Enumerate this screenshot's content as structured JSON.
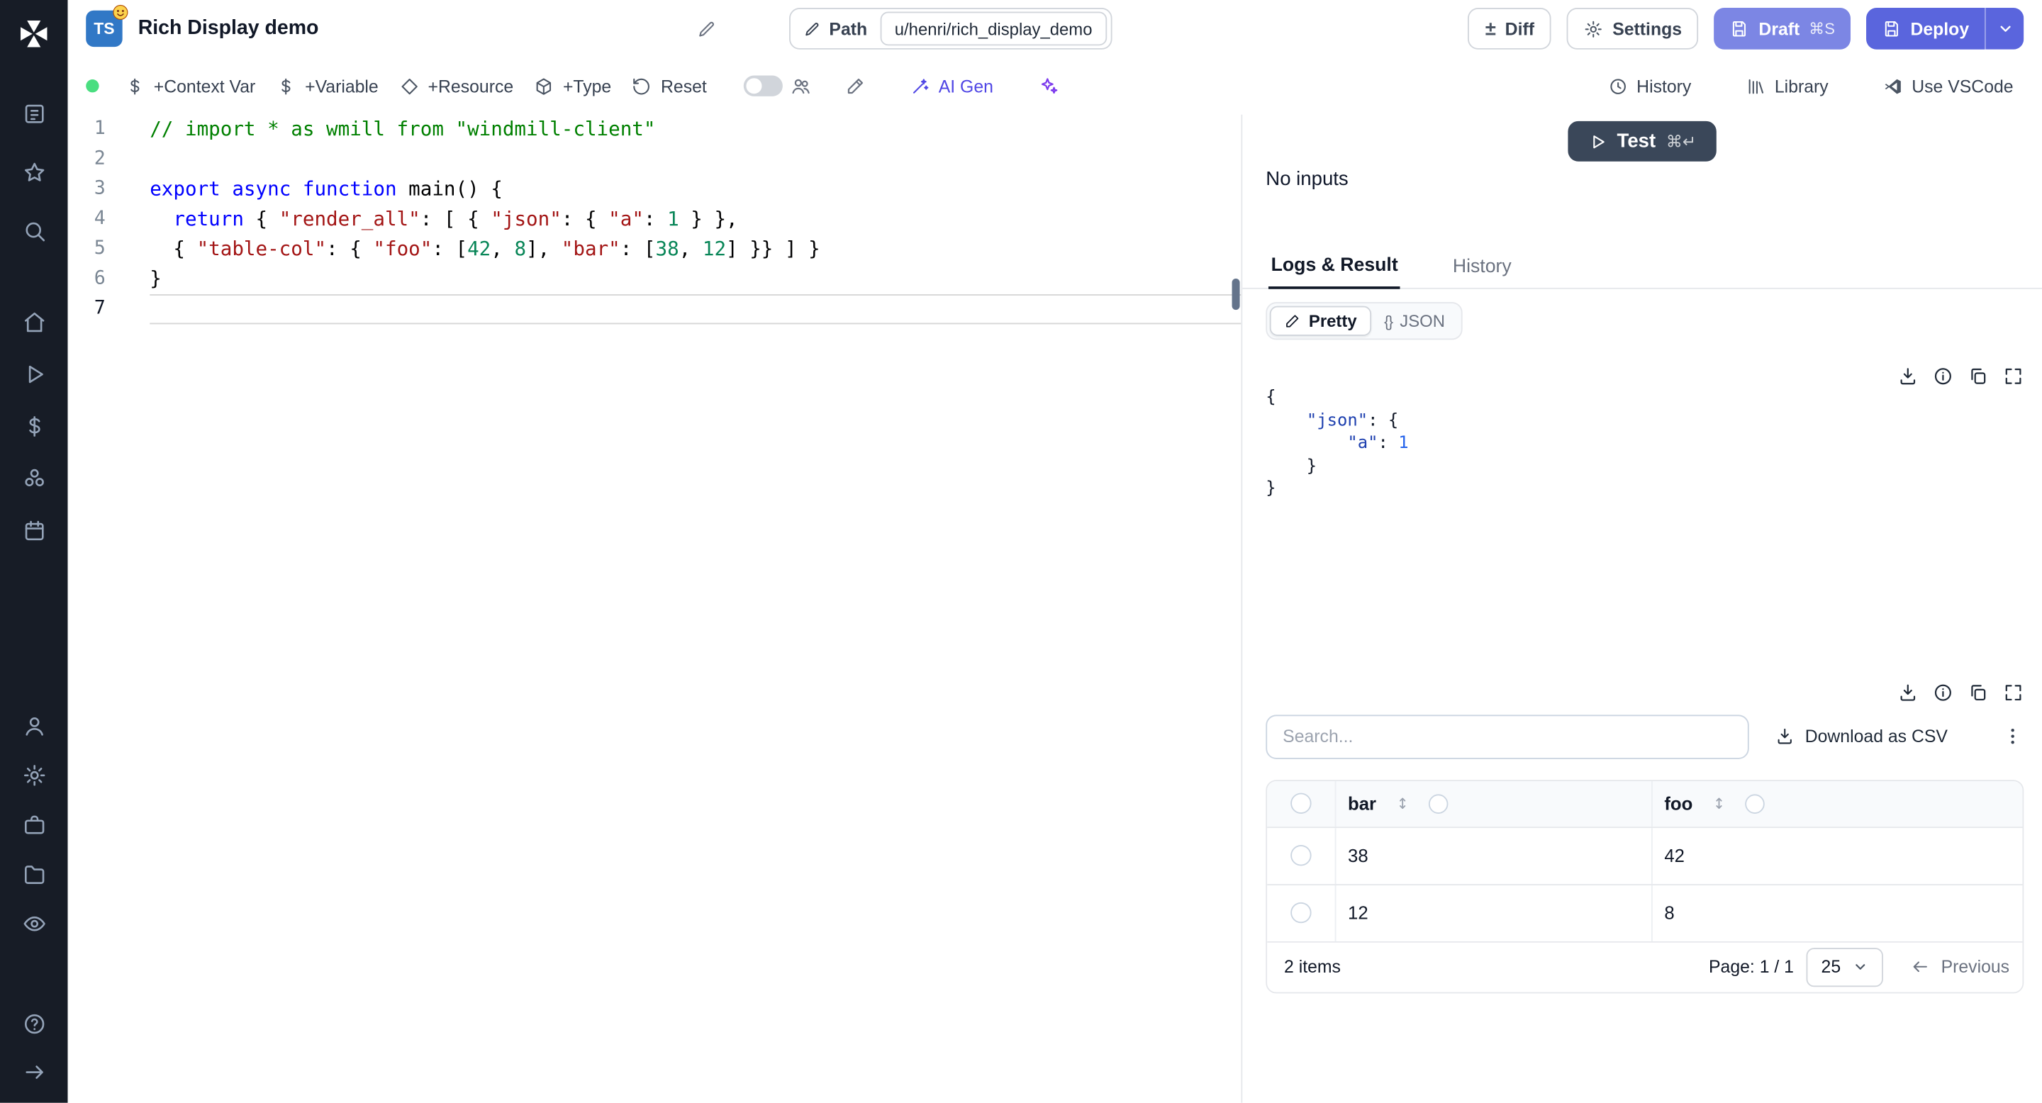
{
  "header": {
    "lang_badge": "TS",
    "title": "Rich Display demo",
    "path_label": "Path",
    "path_value": "u/henri/rich_display_demo",
    "diff_icon": "±",
    "diff_label": "Diff",
    "settings_label": "Settings",
    "draft_label": "Draft",
    "draft_shortcut": "⌘S",
    "deploy_label": "Deploy"
  },
  "toolbar": {
    "context_var": "+Context Var",
    "variable": "+Variable",
    "resource": "+Resource",
    "type": "+Type",
    "reset": "Reset",
    "ai_gen": "AI Gen",
    "history": "History",
    "library": "Library",
    "use_vscode": "Use VSCode"
  },
  "sidebar": {
    "groups": [
      [
        "kanban",
        "star",
        "search"
      ],
      [
        "home",
        "play",
        "dollar",
        "apps",
        "calendar"
      ],
      [
        "user",
        "gear",
        "briefcase",
        "folder",
        "eye"
      ],
      [
        "help",
        "arrow-right"
      ]
    ]
  },
  "editor": {
    "active_line": 7,
    "lines": [
      [
        {
          "c": "comment",
          "t": "// import * as wmill from \"windmill-client\""
        }
      ],
      [],
      [
        {
          "c": "kw",
          "t": "export"
        },
        {
          "c": "pl",
          "t": " "
        },
        {
          "c": "kw",
          "t": "async"
        },
        {
          "c": "pl",
          "t": " "
        },
        {
          "c": "kw",
          "t": "function"
        },
        {
          "c": "pl",
          "t": " main() {"
        }
      ],
      [
        {
          "c": "pl",
          "t": "  "
        },
        {
          "c": "kw",
          "t": "return"
        },
        {
          "c": "pl",
          "t": " { "
        },
        {
          "c": "str",
          "t": "\"render_all\""
        },
        {
          "c": "pl",
          "t": ": [ { "
        },
        {
          "c": "str",
          "t": "\"json\""
        },
        {
          "c": "pl",
          "t": ": { "
        },
        {
          "c": "str",
          "t": "\"a\""
        },
        {
          "c": "pl",
          "t": ": "
        },
        {
          "c": "num",
          "t": "1"
        },
        {
          "c": "pl",
          "t": " } },"
        }
      ],
      [
        {
          "c": "pl",
          "t": "  { "
        },
        {
          "c": "str",
          "t": "\"table-col\""
        },
        {
          "c": "pl",
          "t": ": { "
        },
        {
          "c": "str",
          "t": "\"foo\""
        },
        {
          "c": "pl",
          "t": ": ["
        },
        {
          "c": "num",
          "t": "42"
        },
        {
          "c": "pl",
          "t": ", "
        },
        {
          "c": "num",
          "t": "8"
        },
        {
          "c": "pl",
          "t": "], "
        },
        {
          "c": "str",
          "t": "\"bar\""
        },
        {
          "c": "pl",
          "t": ": ["
        },
        {
          "c": "num",
          "t": "38"
        },
        {
          "c": "pl",
          "t": ", "
        },
        {
          "c": "num",
          "t": "12"
        },
        {
          "c": "pl",
          "t": "] }} ] }"
        }
      ],
      [
        {
          "c": "pl",
          "t": "}"
        }
      ],
      []
    ]
  },
  "right_panel": {
    "test_label": "Test",
    "test_shortcut": "⌘↵",
    "no_inputs": "No inputs",
    "tabs": [
      "Logs & Result",
      "History"
    ],
    "view_pretty": "Pretty",
    "view_json_icon": "{}",
    "view_json": "JSON",
    "result_lines": [
      [
        {
          "c": "rp",
          "t": "{"
        }
      ],
      [
        {
          "c": "rp",
          "t": "    "
        },
        {
          "c": "rk",
          "t": "\"json\""
        },
        {
          "c": "rp",
          "t": ": {"
        }
      ],
      [
        {
          "c": "rp",
          "t": "        "
        },
        {
          "c": "rk",
          "t": "\"a\""
        },
        {
          "c": "rp",
          "t": ": "
        },
        {
          "c": "rn",
          "t": "1"
        }
      ],
      [
        {
          "c": "rp",
          "t": "    }"
        }
      ],
      [
        {
          "c": "rp",
          "t": "}"
        }
      ]
    ],
    "table": {
      "search_placeholder": "Search...",
      "download_csv": "Download as CSV",
      "columns": [
        "bar",
        "foo"
      ],
      "rows": [
        [
          "38",
          "42"
        ],
        [
          "12",
          "8"
        ]
      ],
      "items_label": "2 items",
      "page_label": "Page: 1 / 1",
      "page_size": "25",
      "previous_label": "Previous"
    }
  },
  "icons": {
    "sidebar": [
      "windmill-logo",
      "kanban",
      "star",
      "search",
      "home",
      "play",
      "dollar",
      "apps",
      "calendar",
      "user",
      "gear",
      "briefcase",
      "folder",
      "eye",
      "help",
      "arrow-right"
    ],
    "header": [
      "pencil",
      "plus-minus",
      "gear",
      "save",
      "chevron-down",
      "smiley-emoji"
    ],
    "toolbar": [
      "dollar",
      "diamond",
      "cube",
      "rotate-ccw",
      "toggle",
      "users",
      "brush",
      "wand",
      "sparkles",
      "clock",
      "library",
      "vscode"
    ],
    "result_panel": [
      "play",
      "download",
      "info",
      "copy",
      "expand",
      "sort",
      "kebab",
      "arrow-left",
      "chevron-down"
    ]
  },
  "colors": {
    "sidebar_bg": "#171c26",
    "accent_indigo": "#5a65dd",
    "accent_indigo_light": "#7c86e4",
    "status_green": "#4ade80",
    "ts_blue": "#3178c6",
    "ai_violet": "#4f46e5"
  }
}
